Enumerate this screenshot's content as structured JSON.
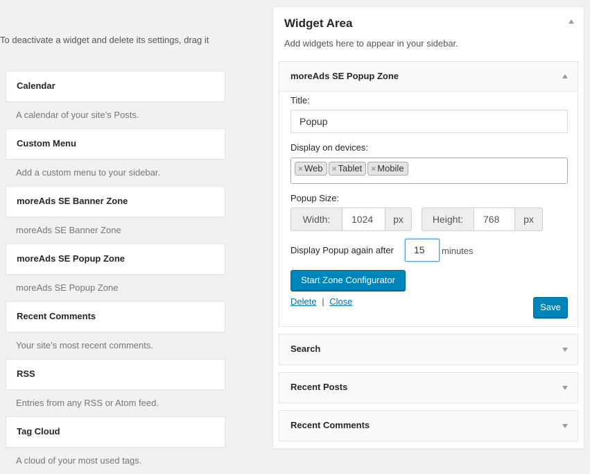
{
  "intro_text": "To deactivate a widget and delete its settings, drag it",
  "available_widgets": [
    {
      "title": "Calendar",
      "description": "A calendar of your site’s Posts."
    },
    {
      "title": "Custom Menu",
      "description": "Add a custom menu to your sidebar."
    },
    {
      "title": "moreAds SE Banner Zone",
      "description": "moreAds SE Banner Zone"
    },
    {
      "title": "moreAds SE Popup Zone",
      "description": "moreAds SE Popup Zone"
    },
    {
      "title": "Recent Comments",
      "description": "Your site’s most recent comments."
    },
    {
      "title": "RSS",
      "description": "Entries from any RSS or Atom feed."
    },
    {
      "title": "Tag Cloud",
      "description": "A cloud of your most used tags."
    }
  ],
  "sidebar": {
    "title": "Widget Area",
    "description": "Add widgets here to appear in your sidebar.",
    "open_widget": {
      "title": "moreAds SE Popup Zone",
      "title_label": "Title:",
      "title_value": "Popup",
      "devices_label": "Display on devices:",
      "devices": [
        "Web",
        "Tablet",
        "Mobile"
      ],
      "tag_remove_glyph": "×",
      "popup_size_label": "Popup Size:",
      "width_label": "Width:",
      "width_value": "1024",
      "height_label": "Height:",
      "height_value": "768",
      "unit": "px",
      "again_label": "Display Popup again after",
      "again_value": "15",
      "minutes_label": "minutes",
      "configurator_button": "Start Zone Configurator",
      "delete_link": "Delete",
      "separator": "|",
      "close_link": "Close",
      "save_button": "Save"
    },
    "closed_widgets": [
      "Search",
      "Recent Posts",
      "Recent Comments"
    ]
  },
  "colors": {
    "primary_button": "#0085ba",
    "link": "#0073aa",
    "background": "#f1f1f1"
  }
}
